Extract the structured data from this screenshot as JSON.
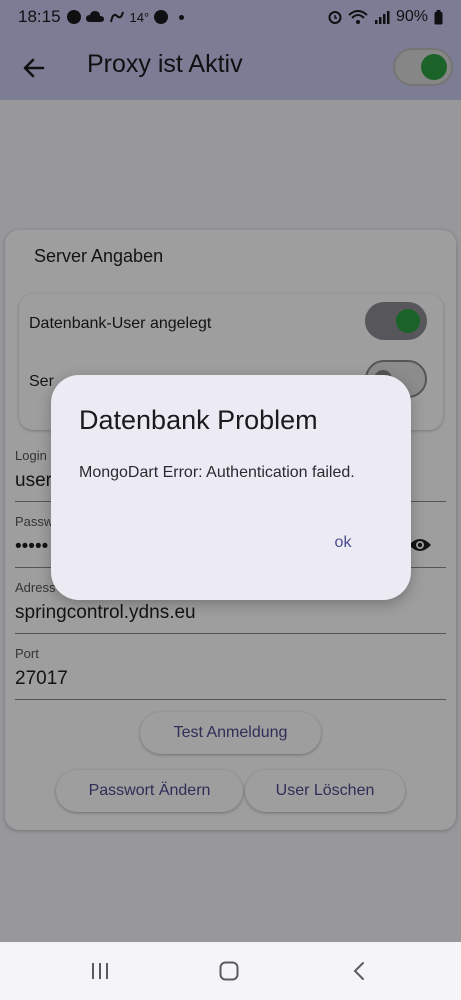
{
  "status_bar": {
    "time": "18:15",
    "temperature": "14°",
    "battery": "90%",
    "icons": [
      "chat-icon",
      "cloud-icon",
      "nav-icon",
      "spotify-icon",
      "alarm-icon",
      "wifi-icon",
      "signal-icon",
      "battery-icon"
    ]
  },
  "app_bar": {
    "title": "Proxy ist Aktiv",
    "back_icon": "back-arrow-icon",
    "proxy_switch_on": true
  },
  "server_card": {
    "title": "Server Angaben",
    "toggles": [
      {
        "label": "Datenbank-User angelegt",
        "on": true
      },
      {
        "label": "Ser",
        "on": false
      }
    ],
    "fields": [
      {
        "label": "Login",
        "value": "user"
      },
      {
        "label": "Passw",
        "value": "•••••",
        "icon": "eye-icon"
      },
      {
        "label": "Adress",
        "value": "springcontrol.ydns.eu"
      },
      {
        "label": "Port",
        "value": "27017"
      }
    ],
    "buttons": {
      "test_login": "Test Anmeldung",
      "change_password": "Passwort Ändern",
      "delete_user": "User Löschen"
    }
  },
  "dialog": {
    "title": "Datenbank Problem",
    "message": "MongoDart Error: Authentication failed.",
    "ok_label": "ok"
  },
  "nav_bar": {
    "icons": [
      "recent-apps-icon",
      "home-icon",
      "back-icon"
    ]
  },
  "colors": {
    "app_bar": "#c9c9ef",
    "switch_green": "#2ea043",
    "accent_text": "#4b4b8f",
    "dialog_bg": "#ecebf4"
  }
}
